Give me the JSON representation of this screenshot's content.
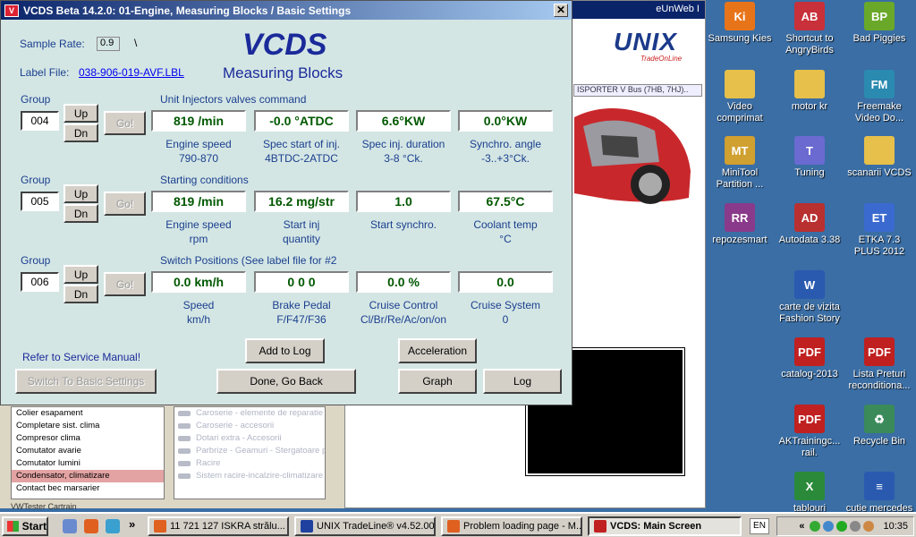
{
  "window": {
    "title": "VCDS Beta 14.2.0: 01-Engine,  Measuring Blocks / Basic Settings",
    "close_glyph": "✕"
  },
  "header": {
    "sample_rate_label": "Sample Rate:",
    "sample_rate_value": "0.9",
    "sample_rate_extra": "\\",
    "label_file_label": "Label File:",
    "label_file_link": "038-906-019-AVF.LBL",
    "app_name": "VCDS",
    "subtitle": "Measuring Blocks"
  },
  "groups": [
    {
      "label": "Group",
      "number": "004",
      "up": "Up",
      "dn": "Dn",
      "go": "Go!",
      "title": "Unit Injectors valves command",
      "fields": [
        {
          "value": "819 /min",
          "label1": "Engine speed",
          "label2": "790-870"
        },
        {
          "value": "-0.0 °ATDC",
          "label1": "Spec start of inj.",
          "label2": "4BTDC-2ATDC"
        },
        {
          "value": "6.6°KW",
          "label1": "Spec inj. duration",
          "label2": "3-8 °Ck."
        },
        {
          "value": "0.0°KW",
          "label1": "Synchro. angle",
          "label2": "-3..+3°Ck."
        }
      ]
    },
    {
      "label": "Group",
      "number": "005",
      "up": "Up",
      "dn": "Dn",
      "go": "Go!",
      "title": "Starting conditions",
      "fields": [
        {
          "value": "819 /min",
          "label1": "Engine speed",
          "label2": "rpm"
        },
        {
          "value": "16.2 mg/str",
          "label1": "Start inj",
          "label2": "quantity"
        },
        {
          "value": "1.0",
          "label1": "Start synchro.",
          "label2": ""
        },
        {
          "value": "67.5°C",
          "label1": "Coolant temp",
          "label2": "°C"
        }
      ]
    },
    {
      "label": "Group",
      "number": "006",
      "up": "Up",
      "dn": "Dn",
      "go": "Go!",
      "title": "Switch Positions (See label file for #2",
      "fields": [
        {
          "value": "0.0 km/h",
          "label1": "Speed",
          "label2": "km/h"
        },
        {
          "value": "0  0  0",
          "label1": "Brake Pedal",
          "label2": "F/F47/F36"
        },
        {
          "value": "0.0 %",
          "label1": "Cruise Control",
          "label2": "Cl/Br/Re/Ac/on/on"
        },
        {
          "value": "0.0",
          "label1": "Cruise System",
          "label2": "0"
        }
      ]
    }
  ],
  "footer": {
    "refer_text": "Refer to Service Manual!",
    "switch_basic": "Switch To Basic Settings",
    "add_to_log": "Add to Log",
    "acceleration": "Acceleration",
    "done": "Done, Go Back",
    "graph": "Graph",
    "log": "Log"
  },
  "background": {
    "browser_top_text": "eUnWeb I",
    "logo_text": "UNIX",
    "logo_sub": "TradeOnLine",
    "bus_field": "ISPORTER V Bus (7HB, 7HJ)..",
    "left_list": [
      "Colier esapament",
      "Completare sist. clima",
      "Compresor clima",
      "Comutator avarie",
      "Comutator lumini",
      "Condensator, climatizare",
      "Contact bec marsarier"
    ],
    "left_list_selected": 5,
    "right_list": [
      "Caroserie - elemente de reparatie",
      "Caroserie - accesorii",
      "Dotari extra - Accesorii",
      "Parbrize - Geamuri - Stergatoare p",
      "Racire",
      "Sistem racire-incalzire-climatizare"
    ],
    "bottom_labels": "VWTester        Cartrain"
  },
  "desktop": {
    "icons": [
      {
        "label": "Samsung Kies",
        "glyph": "Ki",
        "color": "#e8741a"
      },
      {
        "label": "Shortcut to AngryBirds",
        "glyph": "AB",
        "color": "#c8303a"
      },
      {
        "label": "Bad Piggies",
        "glyph": "BP",
        "color": "#6aa82a"
      },
      {
        "label": "Video comprimat",
        "glyph": "",
        "color": "#e6c04a"
      },
      {
        "label": "motor kr",
        "glyph": "",
        "color": "#e6c04a"
      },
      {
        "label": "Freemake Video Do...",
        "glyph": "FM",
        "color": "#2a8ab0"
      },
      {
        "label": "MiniTool Partition ...",
        "glyph": "MT",
        "color": "#d0a030"
      },
      {
        "label": "Tuning",
        "glyph": "T",
        "color": "#6a6ad0"
      },
      {
        "label": "scanarii VCDS",
        "glyph": "",
        "color": "#e6c04a"
      },
      {
        "label": "repozesmart",
        "glyph": "RR",
        "color": "#8a3a8a"
      },
      {
        "label": "Autodata 3.38",
        "glyph": "AD",
        "color": "#b83030"
      },
      {
        "label": "ETKA 7.3 PLUS 2012",
        "glyph": "ET",
        "color": "#3a6ad0"
      },
      {
        "label": "carte de vizita Fashion Story",
        "glyph": "W",
        "color": "#2a5ab0"
      },
      {
        "label": "catalog-2013",
        "glyph": "PDF",
        "color": "#c02020"
      },
      {
        "label": "Lista Preturi reconditiona...",
        "glyph": "PDF",
        "color": "#c02020"
      },
      {
        "label": "AKTrainingc... rail.",
        "glyph": "PDF",
        "color": "#c02020"
      },
      {
        "label": "Recycle Bin",
        "glyph": "♻",
        "color": "#3a8a5a"
      },
      {
        "label": "tablouri",
        "glyph": "X",
        "color": "#2a8a3a"
      },
      {
        "label": "cutie mercedes",
        "glyph": "≡",
        "color": "#2a5ab0"
      }
    ]
  },
  "taskbar": {
    "start": "Start",
    "more": "»",
    "tasks": [
      {
        "label": "11 721 127 ISKRA strălu...",
        "color": "#e06020",
        "active": false
      },
      {
        "label": "UNIX TradeLine® v4.52.00",
        "color": "#2040a0",
        "active": false
      },
      {
        "label": "Problem loading page - M...",
        "color": "#e06020",
        "active": false
      },
      {
        "label": "VCDS:  Main Screen",
        "color": "#c02020",
        "active": true
      }
    ],
    "lang": "EN",
    "tray_arrows": "«",
    "clock": "10:35"
  }
}
